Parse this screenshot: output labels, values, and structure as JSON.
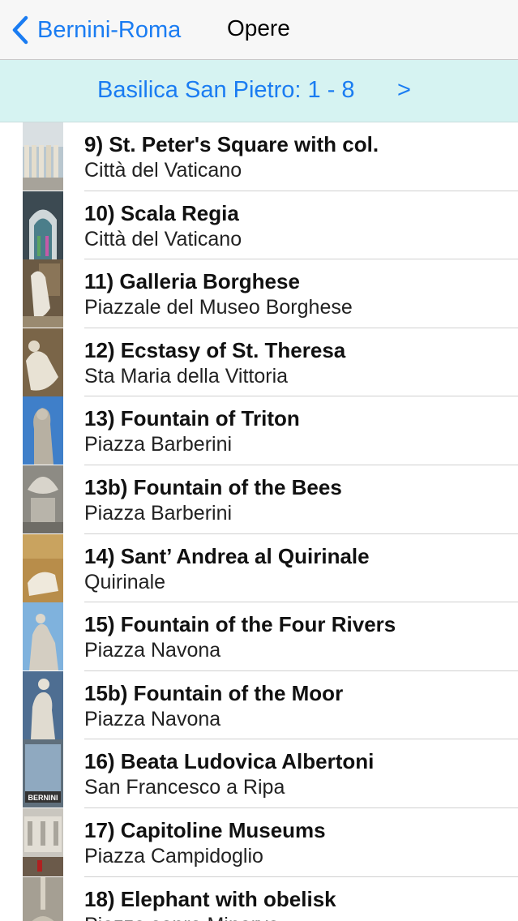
{
  "navbar": {
    "back_label": "Bernini-Roma",
    "title": "Opere"
  },
  "section": {
    "title": "Basilica San Pietro: 1 - 8",
    "next_label": ">"
  },
  "items": [
    {
      "title": "9) St. Peter's Square with col.",
      "subtitle": "Città del Vaticano"
    },
    {
      "title": "10) Scala Regia",
      "subtitle": "Città del Vaticano"
    },
    {
      "title": "11) Galleria Borghese",
      "subtitle": "Piazzale del Museo Borghese"
    },
    {
      "title": "12) Ecstasy of St. Theresa",
      "subtitle": "Sta Maria della Vittoria"
    },
    {
      "title": "13) Fountain of Triton",
      "subtitle": "Piazza Barberini"
    },
    {
      "title": "13b) Fountain of the Bees",
      "subtitle": "Piazza Barberini"
    },
    {
      "title": "14) Sant’ Andrea al Quirinale",
      "subtitle": "Quirinale"
    },
    {
      "title": "15) Fountain of the Four Rivers",
      "subtitle": "Piazza Navona"
    },
    {
      "title": "15b) Fountain of the Moor",
      "subtitle": "Piazza Navona"
    },
    {
      "title": "16) Beata Ludovica Albertoni",
      "subtitle": "San Francesco a Ripa"
    },
    {
      "title": "17) Capitoline Museums",
      "subtitle": "Piazza Campidoglio"
    },
    {
      "title": "18) Elephant with obelisk",
      "subtitle": "Piazza sopra Minerva"
    }
  ],
  "thumb_label_16": "BERNINI",
  "colors": {
    "accent": "#1a7cf2",
    "header_bg": "#d6f3f2",
    "navbar_bg": "#f7f7f7"
  }
}
